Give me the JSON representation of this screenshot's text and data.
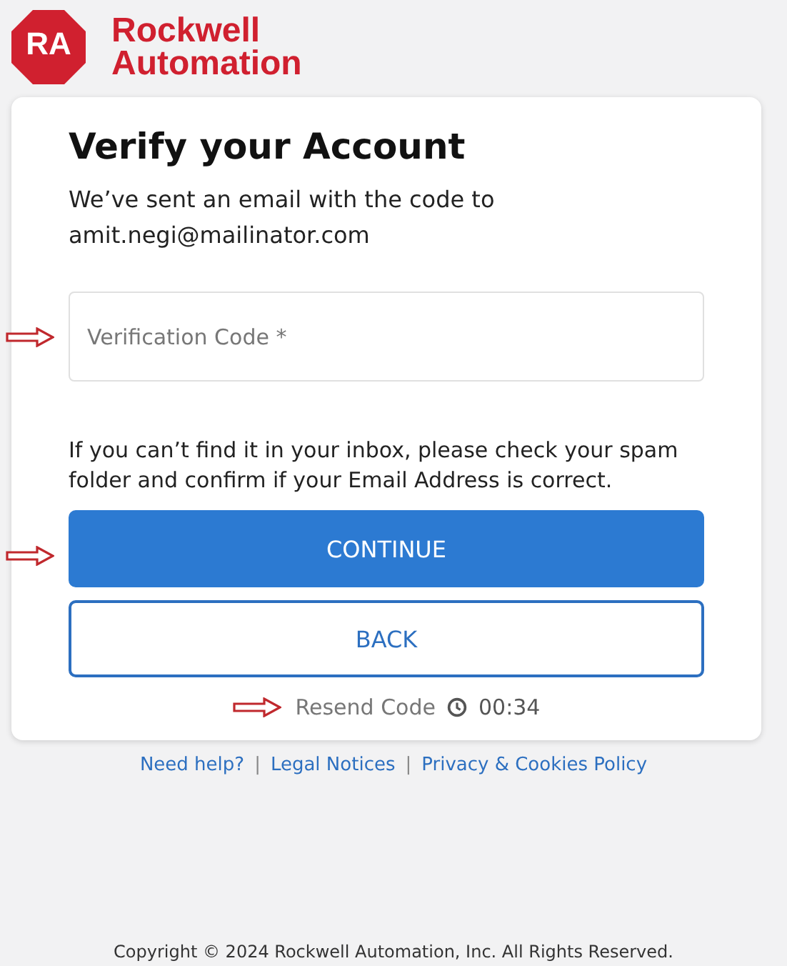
{
  "logo": {
    "badge": "RA",
    "name_line_1": "Rockwell",
    "name_line_2": "Automation"
  },
  "card": {
    "title": "Verify your Account",
    "message": "We’ve sent an email with the code to",
    "email": "amit.negi@mailinator.com",
    "code_field": {
      "placeholder": "Verification Code *"
    },
    "hint": "If you can’t find it in your inbox, please check your spam folder and confirm if your Email Address is correct.",
    "buttons": [
      {
        "label": "CONTINUE",
        "kind": "primary"
      },
      {
        "label": "BACK",
        "kind": "secondary"
      }
    ],
    "resend": {
      "label": "Resend Code",
      "disabled": true,
      "timer": "00:34"
    }
  },
  "footer_links": [
    {
      "label": "Need help?"
    },
    {
      "label": "Legal Notices"
    },
    {
      "label": "Privacy & Cookies Policy"
    }
  ],
  "separators": [
    "|",
    "|"
  ],
  "copyright": "Copyright © 2024 Rockwell Automation, Inc. All Rights Reserved."
}
